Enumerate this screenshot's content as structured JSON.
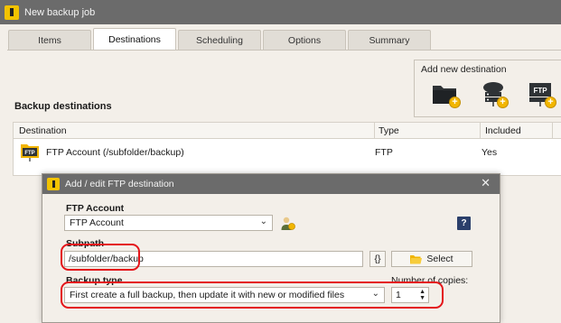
{
  "window": {
    "title": "New backup job"
  },
  "tabs": [
    {
      "label": "Items"
    },
    {
      "label": "Destinations"
    },
    {
      "label": "Scheduling"
    },
    {
      "label": "Options"
    },
    {
      "label": "Summary"
    }
  ],
  "add_destination": {
    "label": "Add new destination"
  },
  "backup_destinations": {
    "title": "Backup destinations",
    "columns": [
      "Destination",
      "Type",
      "Included"
    ],
    "rows": [
      {
        "destination": "FTP Account (/subfolder/backup)",
        "type": "FTP",
        "included": "Yes"
      }
    ]
  },
  "dialog": {
    "title": "Add / edit FTP destination",
    "ftp_account_label": "FTP Account",
    "ftp_account_value": "FTP Account",
    "help": "?",
    "subpath_label": "Subpath",
    "subpath_value": "/subfolder/backup",
    "braces": "{}",
    "select_button": "Select",
    "backup_type_label": "Backup type",
    "backup_type_value": "First create a full backup, then update it with new or modified files",
    "copies_label": "Number of copies:",
    "copies_value": "1"
  },
  "colors": {
    "highlight": "#e4151a",
    "accent": "#f2b600",
    "titlebar": "#6b6b6b"
  }
}
